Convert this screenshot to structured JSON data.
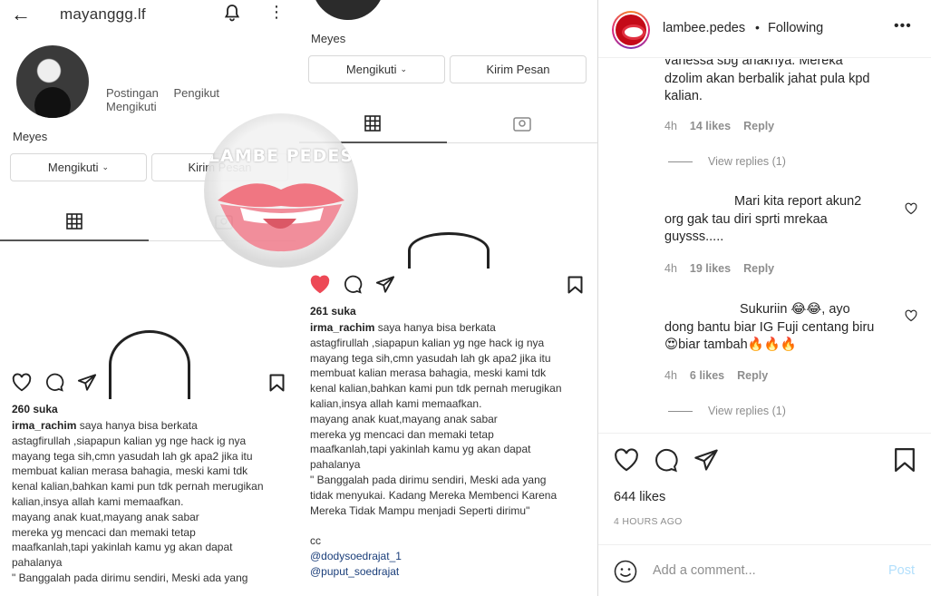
{
  "post_image": {
    "panel1": {
      "username": "mayanggg.lf",
      "stats": [
        "Postingan",
        "Pengikut",
        "Mengikuti"
      ],
      "display_name": "Meyes",
      "follow_button": "Mengikuti",
      "message_button": "Kirim Pesan",
      "likes": "260 suka",
      "caption_user": "irma_rachim",
      "caption_text": " saya hanya bisa berkata\nastagfirullah ,siapapun kalian yg nge hack ig nya\nmayang tega sih,cmn yasudah lah gk apa2 jika itu\nmembuat kalian merasa bahagia, meski kami tdk\nkenal kalian,bahkan kami pun tdk pernah merugikan\nkalian,insya allah kami memaafkan.\nmayang anak kuat,mayang anak sabar\nmereka yg mencaci dan memaki tetap\nmaafkanlah,tapi yakinlah kamu yg akan dapat\npahalanya\n\" Banggalah pada dirimu sendiri, Meski ada yang"
    },
    "panel2": {
      "display_name": "Meyes",
      "follow_button": "Mengikuti",
      "message_button": "Kirim Pesan",
      "likes": "261 suka",
      "caption_user": "irma_rachim",
      "caption_text": " saya hanya bisa berkata\nastagfirullah ,siapapun kalian yg nge hack ig nya\nmayang tega sih,cmn yasudah lah gk apa2 jika itu\nmembuat kalian merasa bahagia, meski kami tdk\nkenal kalian,bahkan kami pun tdk pernah merugikan\nkalian,insya allah kami memaafkan.\nmayang anak kuat,mayang anak sabar\nmereka yg mencaci dan memaki tetap\nmaafkanlah,tapi yakinlah kamu yg akan dapat\npahalanya\n\" Banggalah pada dirimu sendiri, Meski ada yang\ntidak menyukai. Kadang Mereka Membenci Karena\nMereka Tidak Mampu menjadi Seperti dirimu\"",
      "cc": "cc",
      "mentions": [
        "@dodysoedrajat_1",
        "@puput_soedrajat"
      ]
    },
    "watermark_text": "LAMBE PEDES"
  },
  "header": {
    "username": "lambee.pedes",
    "separator": "•",
    "follow_status": "Following",
    "more_icon": "more-horizontal-icon"
  },
  "comments": [
    {
      "text": "vanessa sbg anaknya. Mereka\ndzolim akan berbalik jahat pula kpd\nkalian.",
      "time": "4h",
      "likes": "14 likes",
      "reply": "Reply",
      "view_replies": "View replies (1)"
    },
    {
      "text": "Mari kita report akun2\norg gak tau diri sprti mrekaa\nguysss.....",
      "time": "4h",
      "likes": "19 likes",
      "reply": "Reply"
    },
    {
      "text": "Sukuriin 😂😂, ayo\ndong bantu biar IG Fuji centang biru\n😍biar tambah🔥🔥🔥",
      "time": "4h",
      "likes": "6 likes",
      "reply": "Reply",
      "view_replies": "View replies (1)"
    }
  ],
  "actions": {
    "likes": "644 likes",
    "time_ago": "4 HOURS AGO"
  },
  "add_comment": {
    "placeholder": "Add a comment...",
    "post_label": "Post"
  }
}
